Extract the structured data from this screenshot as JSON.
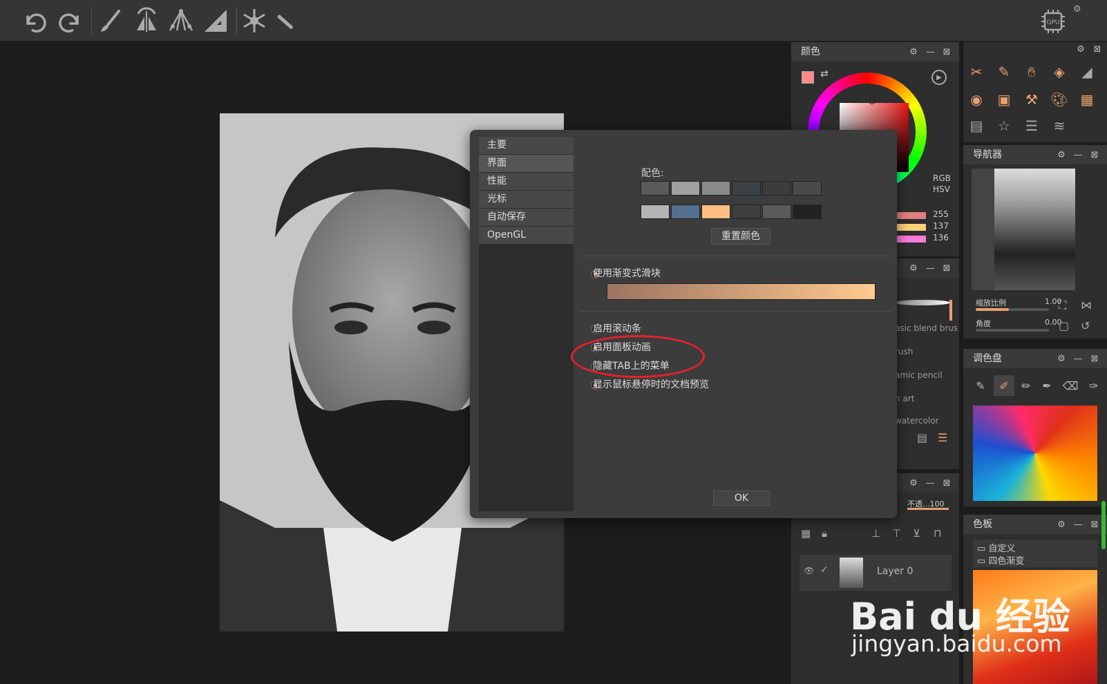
{
  "toolbar": {
    "icons": [
      "undo-icon",
      "redo-icon",
      "brush-icon",
      "symmetry-icon",
      "perspective-icon",
      "ruler-icon",
      "snowflake-icon",
      "pen-small-icon"
    ],
    "gpu_label": "GPU"
  },
  "color_panel": {
    "title": "颜色",
    "mode_rgb": "RGB",
    "mode_hsv": "HSV",
    "values": [
      "255",
      "137",
      "136"
    ],
    "fg_color": "#ff8a88"
  },
  "navigator_panel": {
    "title": "导航器",
    "zoom_label": "缩放比例",
    "zoom_value": "1.00",
    "angle_label": "角度",
    "angle_value": "0.00"
  },
  "palette_panel": {
    "title": "调色盘"
  },
  "swatch_panel": {
    "title": "色板",
    "folders": [
      "自定义",
      "四色渐变"
    ]
  },
  "brush_panel": {
    "items": [
      "asic blend brus",
      "rush",
      "amic pencil",
      "n art",
      "watercolor"
    ]
  },
  "layers_panel": {
    "opacity_label": "不透...100",
    "layer_name": "Layer 0"
  },
  "dialog": {
    "nav": [
      "主要",
      "界面",
      "性能",
      "光标",
      "自动保存",
      "OpenGL"
    ],
    "active_nav": 1,
    "scheme_label": "配色:",
    "swatches_row1": [
      "#5a5a5a",
      "#a0a0a0",
      "#8a8a8a",
      "#3a4044",
      "#3c3c3c",
      "#4a4a4a"
    ],
    "swatches_row2": [
      "#b4b4b4",
      "#55708f",
      "#ffbe82",
      "#3e3e3e",
      "#5a5a5a",
      "#222222"
    ],
    "reset_label": "重置颜色",
    "gradient_slider_label": "使用渐变式滑块",
    "options": [
      {
        "label": "启用滚动条",
        "on": false
      },
      {
        "label": "启用面板动画",
        "on": true
      },
      {
        "label": "隐藏TAB上的菜单",
        "on": false
      },
      {
        "label": "显示鼠标悬停时的文档预览",
        "on": true
      }
    ],
    "ok_label": "OK"
  },
  "watermark": {
    "line1": "Bai  du 经验",
    "line2": "jingyan.baidu.com"
  },
  "colors": {
    "accent": "#e6a06e",
    "highlight_red": "#e8202a"
  }
}
